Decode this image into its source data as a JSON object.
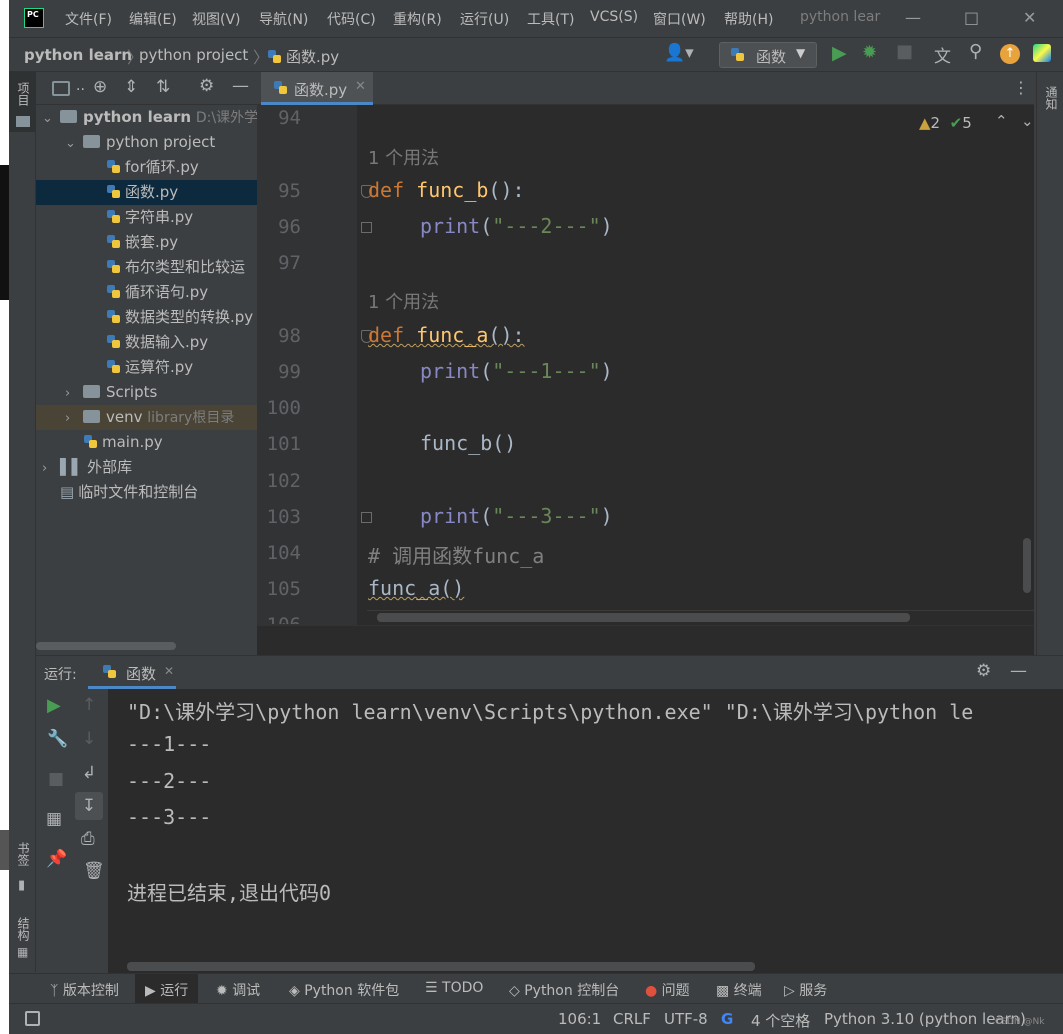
{
  "app": {
    "logo_text": "PC",
    "window_title": "python lear"
  },
  "menu": [
    "文件(F)",
    "编辑(E)",
    "视图(V)",
    "导航(N)",
    "代码(C)",
    "重构(R)",
    "运行(U)",
    "工具(T)",
    "VCS(S)",
    "窗口(W)",
    "帮助(H)"
  ],
  "breadcrumb": [
    "python learn",
    "python project",
    "函数.py"
  ],
  "run_config": {
    "label": "函数"
  },
  "left_tool_labels": {
    "project": "项目",
    "bookmarks": "书签",
    "structure": "结构"
  },
  "right_tool_labels": {
    "notifications": "通知"
  },
  "project_toolbar": {
    "label": ".."
  },
  "tree": [
    {
      "label": "python learn",
      "suffix": "D:\\课外学",
      "depth": 0,
      "type": "folder",
      "expanded": true,
      "bold": true
    },
    {
      "label": "python project",
      "suffix": "",
      "depth": 1,
      "type": "folder",
      "expanded": true
    },
    {
      "label": "for循环.py",
      "suffix": "",
      "depth": 2,
      "type": "py"
    },
    {
      "label": "函数.py",
      "suffix": "",
      "depth": 2,
      "type": "py",
      "selected": true
    },
    {
      "label": "字符串.py",
      "suffix": "",
      "depth": 2,
      "type": "py"
    },
    {
      "label": "嵌套.py",
      "suffix": "",
      "depth": 2,
      "type": "py"
    },
    {
      "label": "布尔类型和比较运",
      "suffix": "",
      "depth": 2,
      "type": "py"
    },
    {
      "label": "循环语句.py",
      "suffix": "",
      "depth": 2,
      "type": "py"
    },
    {
      "label": "数据类型的转换.py",
      "suffix": "",
      "depth": 2,
      "type": "py"
    },
    {
      "label": "数据输入.py",
      "suffix": "",
      "depth": 2,
      "type": "py"
    },
    {
      "label": "运算符.py",
      "suffix": "",
      "depth": 2,
      "type": "py"
    },
    {
      "label": "Scripts",
      "suffix": "",
      "depth": 1,
      "type": "folder",
      "expanded": false
    },
    {
      "label": "venv",
      "suffix": "library根目录",
      "depth": 1,
      "type": "folder",
      "expanded": false,
      "venv": true
    },
    {
      "label": "main.py",
      "suffix": "",
      "depth": 1,
      "type": "py"
    },
    {
      "label": "外部库",
      "suffix": "",
      "depth": 0,
      "type": "lib",
      "expanded": false
    },
    {
      "label": "临时文件和控制台",
      "suffix": "",
      "depth": 0,
      "type": "scratch"
    }
  ],
  "editor": {
    "tab_label": "函数.py",
    "warnings": "2",
    "checks": "5",
    "usage_hint": "1 个用法",
    "line_numbers": [
      "94",
      "95",
      "96",
      "97",
      "98",
      "99",
      "100",
      "101",
      "102",
      "103",
      "104",
      "105",
      "106"
    ],
    "lines": {
      "l95_kw": "def ",
      "l95_fn": "func_b",
      "l95_rest": "():",
      "l96_bi": "print",
      "l96_open": "(",
      "l96_str": "\"---2---\"",
      "l96_close": ")",
      "l98_kw": "def ",
      "l98_fn": "func_a",
      "l98_rest": "():",
      "l99_bi": "print",
      "l99_open": "(",
      "l99_str": "\"---1---\"",
      "l99_close": ")",
      "l101": "func_b()",
      "l103_bi": "print",
      "l103_open": "(",
      "l103_str": "\"---3---\"",
      "l103_close": ")",
      "l104": "# 调用函数func_a",
      "l105": "func_a()"
    }
  },
  "run_panel": {
    "title": "运行:",
    "tab_label": "函数",
    "output": [
      "\"D:\\课外学习\\python learn\\venv\\Scripts\\python.exe\" \"D:\\课外学习\\python le",
      "---1---",
      "---2---",
      "---3---",
      "",
      "进程已结束,退出代码0"
    ]
  },
  "bottom_tools": [
    "版本控制",
    "运行",
    "调试",
    "Python 软件包",
    "TODO",
    "问题",
    "终端",
    "服务",
    "Python 控制台"
  ],
  "status": {
    "position": "106:1",
    "line_sep": "CRLF",
    "encoding": "UTF-8",
    "indent": "4 个空格",
    "interpreter": "Python 3.10 (python learn)",
    "watermark": "CSDN @Nk"
  },
  "colors": {
    "bg": "#2b2b2b",
    "panel": "#3c3f41",
    "keyword": "#cc7832",
    "function": "#ffc66d",
    "builtin": "#8888c6",
    "string": "#6a8759",
    "run_green": "#499c54",
    "selection": "#0d293e"
  }
}
